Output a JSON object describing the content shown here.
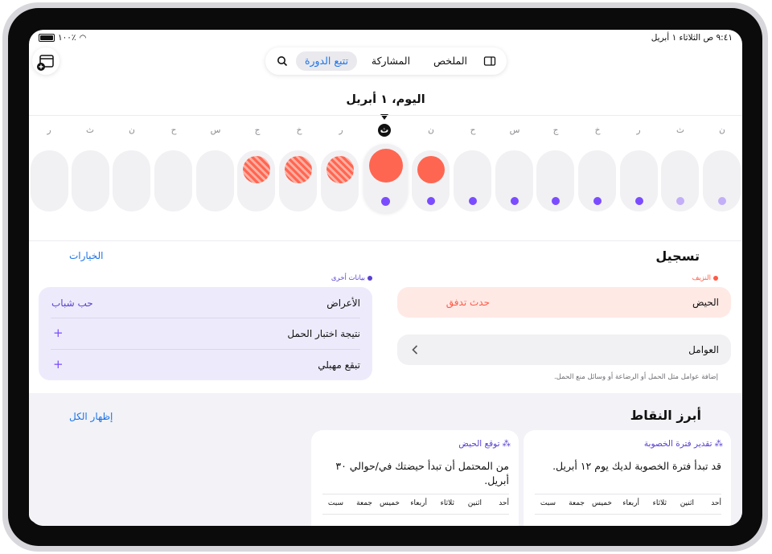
{
  "status_bar": {
    "time_date": "٩:٤١ ص  الثلاثاء ١ أبريل",
    "battery": "١٠٠٪"
  },
  "nav": {
    "items": [
      {
        "label": "تتبع الدورة",
        "active": true
      },
      {
        "label": "المشاركة"
      },
      {
        "label": "الملخص"
      }
    ]
  },
  "calendar": {
    "title": "اليوم، ١ أبريل",
    "week_labels": [
      "ن",
      "ث",
      "ر",
      "خ",
      "ج",
      "س",
      "ح",
      "ن",
      "ث",
      "ر",
      "خ",
      "ج",
      "س",
      "ح",
      "ن",
      "ث",
      "ر"
    ],
    "today_index": 8
  },
  "logging": {
    "title": "تسجيل",
    "options_link": "الخيارات",
    "bleeding_legend": "النزيف",
    "other_legend": "بيانات أخرى",
    "period_row": {
      "label": "الحيض",
      "value": "حدث تدفق"
    },
    "factors_row": {
      "label": "العوامل"
    },
    "factors_hint": "إضافة عوامل مثل الحمل أو الرضاعة أو وسائل منع الحمل.",
    "symptoms": {
      "label": "الأعراض",
      "value": "حب شباب"
    },
    "pregnancy_test": {
      "label": "نتيجة اختبار الحمل"
    },
    "spotting": {
      "label": "تبقع مهبلي"
    }
  },
  "highlights": {
    "title": "أبرز النقاط",
    "show_all": "إظهار الكل",
    "cards": [
      {
        "tag": "تقدير فترة الخصوبة",
        "text": "قد تبدأ فترة الخصوبة لديك يوم ١٢ أبريل."
      },
      {
        "tag": "توقع الحيض",
        "text": "من المحتمل أن تبدأ حيضتك في/حوالي ٣٠ أبريل."
      }
    ],
    "day_names": [
      "أحد",
      "اثنين",
      "ثلاثاء",
      "أربعاء",
      "خميس",
      "جمعة",
      "سبت"
    ]
  },
  "colors": {
    "accent": "#1e74e6",
    "period": "#ff6651",
    "fertile": "#7b4cff"
  }
}
